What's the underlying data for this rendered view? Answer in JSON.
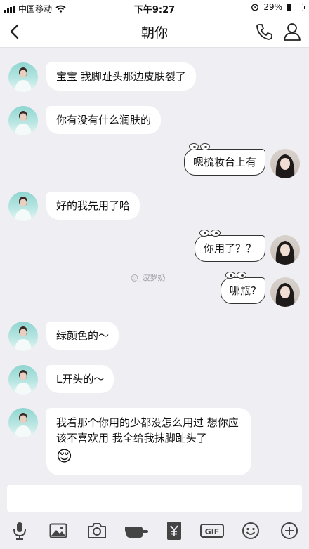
{
  "status": {
    "carrier": "中国移动",
    "time": "下午9:27",
    "battery": "29%",
    "battery_level": 0.29
  },
  "nav": {
    "title": "朝你"
  },
  "messages": [
    {
      "side": "left",
      "text": "宝宝 我脚趾头那边皮肤裂了"
    },
    {
      "side": "left",
      "text": "你有没有什么润肤的"
    },
    {
      "side": "right",
      "text": "嗯梳妆台上有"
    },
    {
      "side": "left",
      "text": "好的我先用了哈"
    },
    {
      "side": "right",
      "text": "你用了？？"
    },
    {
      "side": "right",
      "text": "哪瓶?"
    },
    {
      "side": "left",
      "text": "绿颜色的～"
    },
    {
      "side": "left",
      "text": "L开头的～"
    },
    {
      "side": "left",
      "text": "我看那个你用的少都没怎么用过 想你应该不喜欢用 我全给我抹脚趾头了",
      "emoji": "😌"
    }
  ],
  "watermark": "@_波罗奶",
  "toolbar": [
    "mic-icon",
    "image-icon",
    "camera-icon",
    "poke-icon",
    "red-packet-icon",
    "gif-icon",
    "emoji-icon",
    "plus-icon"
  ],
  "colors": {
    "background": "#eeeef3",
    "bubble": "#ffffff",
    "icon": "#444444"
  }
}
